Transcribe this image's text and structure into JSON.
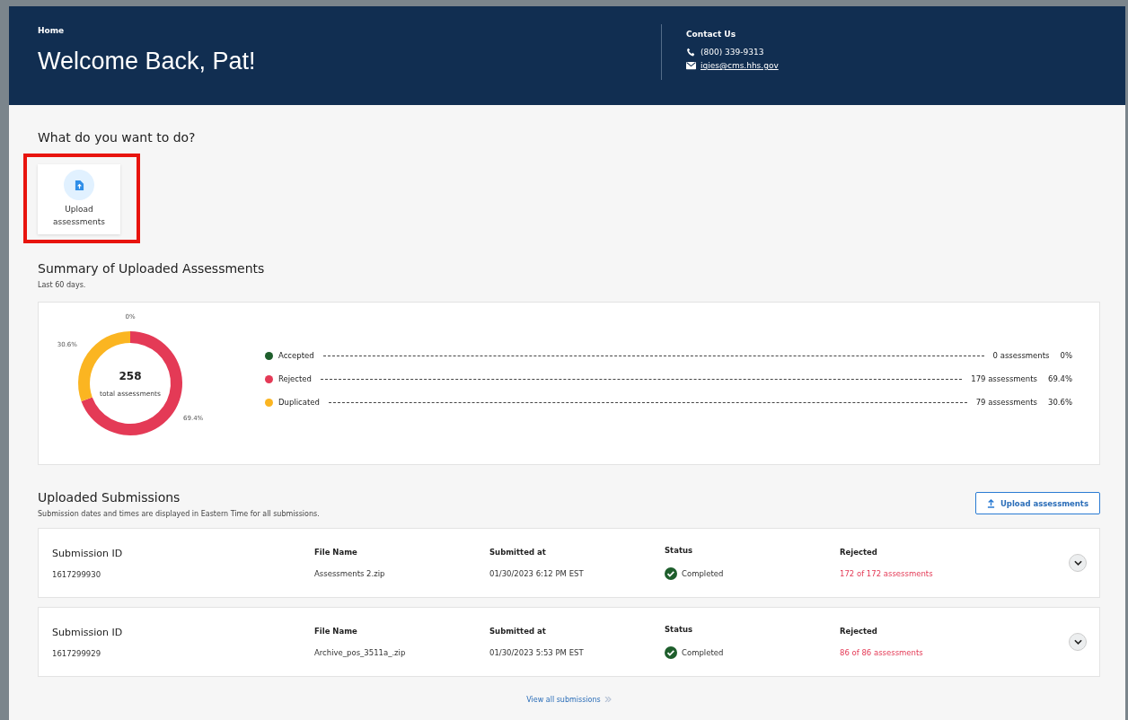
{
  "header": {
    "breadcrumb": "Home",
    "title": "Welcome Back, Pat!",
    "contact": {
      "heading": "Contact Us",
      "phone": "(800) 339-9313",
      "email": "iqies@cms.hhs.gov"
    }
  },
  "actions": {
    "heading": "What do you want to do?",
    "tiles": [
      {
        "label": "Upload assessments",
        "highlighted": true
      }
    ]
  },
  "summary": {
    "heading": "Summary of Uploaded Assessments",
    "subtitle": "Last 60 days.",
    "total": "258",
    "total_label": "total assessments",
    "chart_data": {
      "type": "donut",
      "categories": [
        "Accepted",
        "Rejected",
        "Duplicated"
      ],
      "series": [
        {
          "values": [
            0,
            69.4,
            30.6
          ]
        }
      ],
      "data_labels": "value_labels",
      "value_labels": [
        "0%",
        "69.4%",
        "30.6%"
      ]
    },
    "legend": [
      {
        "color": "#1e5e2c",
        "count": "0 assessments",
        "percent": "0%"
      },
      {
        "color": "#e43a56",
        "count": "179 assessments",
        "percent": "69.4%"
      },
      {
        "color": "#fbb521",
        "count": "79 assessments",
        "percent": "30.6%"
      }
    ]
  },
  "submissions": {
    "heading": "Uploaded Submissions",
    "subtitle": "Submission dates and times are displayed in Eastern Time for all submissions.",
    "upload_button": "Upload assessments",
    "rows": [
      {
        "id_label": "Submission ID",
        "id": "1617299930",
        "file_label": "File Name",
        "file": "Assessments 2.zip",
        "submitted_label": "Submitted at",
        "submitted": "01/30/2023 6:12 PM EST",
        "status_label": "Status",
        "status": "Completed",
        "rejected_label": "Rejected",
        "rejected": "172 of 172 assessments",
        "expanded": false
      },
      {
        "id_label": "Submission ID",
        "id": "1617299929",
        "file_label": "File Name",
        "file": "Archive_pos_3511a_.zip",
        "submitted_label": "Submitted at",
        "submitted": "01/30/2023 5:53 PM EST",
        "status_label": "Status",
        "status": "Completed",
        "rejected_label": "Rejected",
        "rejected": "86 of 86 assessments",
        "expanded": false
      }
    ],
    "view_all": "View all submissions"
  }
}
